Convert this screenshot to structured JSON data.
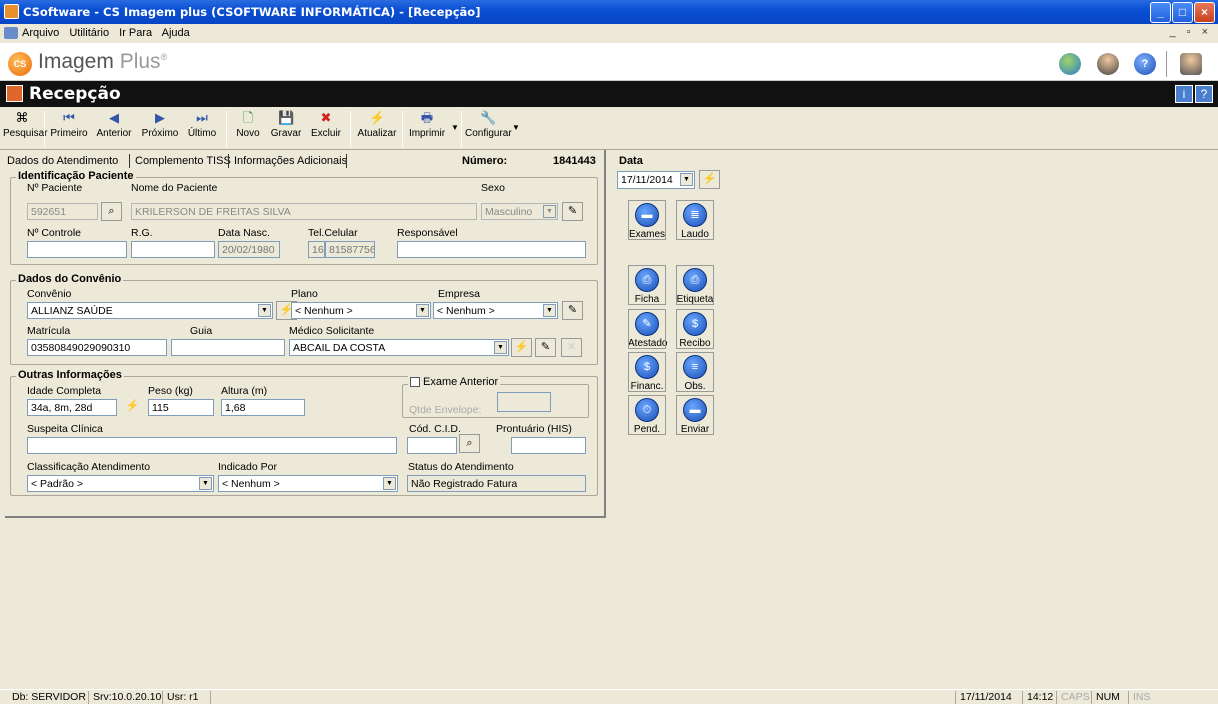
{
  "window": {
    "title": "CSoftware - CS Imagem plus (CSOFTWARE INFORMÁTICA) - [Recepção]",
    "controls": {
      "minimize": "_",
      "maximize": "□",
      "close": "×"
    }
  },
  "menu": {
    "items": [
      "Arquivo",
      "Utilitário",
      "Ir Para",
      "Ajuda"
    ],
    "mdi_controls": "_ ▫ ×"
  },
  "logo": {
    "badge": "CS",
    "brand": "Imagem",
    "brand_plus": "Plus",
    "trademark": "®"
  },
  "header": {
    "title": "Recepção"
  },
  "toolbar": {
    "buttons": [
      {
        "label": "Pesquisar",
        "icon": "binoculars-icon",
        "glyph": "⌘"
      },
      {
        "label": "Primeiro",
        "icon": "first-icon",
        "glyph": "⏮"
      },
      {
        "label": "Anterior",
        "icon": "previous-icon",
        "glyph": "◀"
      },
      {
        "label": "Próximo",
        "icon": "next-icon",
        "glyph": "▶"
      },
      {
        "label": "Último",
        "icon": "last-icon",
        "glyph": "⏭"
      },
      {
        "label": "Novo",
        "icon": "new-document-icon",
        "glyph": "🗋"
      },
      {
        "label": "Gravar",
        "icon": "save-icon",
        "glyph": "💾"
      },
      {
        "label": "Excluir",
        "icon": "delete-icon",
        "glyph": "✖"
      },
      {
        "label": "Atualizar",
        "icon": "lightning-icon",
        "glyph": "⚡"
      },
      {
        "label": "Imprimir",
        "icon": "print-icon",
        "glyph": "🖶"
      },
      {
        "label": "Configurar",
        "icon": "wrench-icon",
        "glyph": "🔧"
      }
    ]
  },
  "tabs": [
    "Dados do Atendimento",
    "Complemento TISS",
    "Informações Adicionais"
  ],
  "numero": {
    "label": "Número:",
    "value": "1841443"
  },
  "data": {
    "label": "Data",
    "value": "17/11/2014"
  },
  "identificacao": {
    "title": "Identificação Paciente",
    "n_paciente_label": "Nº Paciente",
    "n_paciente": "592651",
    "nome_label": "Nome do Paciente",
    "nome": "KRILERSON DE FREITAS SILVA",
    "sexo_label": "Sexo",
    "sexo": "Masculino",
    "n_controle_label": "Nº Controle",
    "n_controle": "",
    "rg_label": "R.G.",
    "rg": "",
    "nasc_label": "Data Nasc.",
    "nasc": "20/02/1980",
    "tel_label": "Tel.Celular",
    "tel_ddd": "16",
    "tel": "81587756",
    "resp_label": "Responsável",
    "resp": ""
  },
  "convenio": {
    "title": "Dados do Convênio",
    "convenio_label": "Convênio",
    "convenio": "ALLIANZ SAÚDE",
    "plano_label": "Plano",
    "plano": "< Nenhum >",
    "empresa_label": "Empresa",
    "empresa": "< Nenhum >",
    "matricula_label": "Matrícula",
    "matricula": "03580849029090310",
    "guia_label": "Guia",
    "guia": "",
    "medico_label": "Médico Solicitante",
    "medico": "ABCAIL DA COSTA"
  },
  "outras": {
    "title": "Outras Informações",
    "idade_label": "Idade Completa",
    "idade": "34a, 8m, 28d",
    "peso_label": "Peso (kg)",
    "peso": "115",
    "altura_label": "Altura (m)",
    "altura": "1,68",
    "exame_anterior_label": "Exame Anterior",
    "qtde_label": "Qtde Envelope:",
    "suspeita_label": "Suspeita Clínica",
    "suspeita": "",
    "cid_label": "Cód. C.I.D.",
    "cid": "",
    "prontuario_label": "Prontuário (HIS)",
    "prontuario": "",
    "classif_label": "Classificação Atendimento",
    "classif": "< Padrão >",
    "indicado_label": "Indicado Por",
    "indicado": "< Nenhum >",
    "status_label": "Status do Atendimento",
    "status": "Não Registrado Fatura"
  },
  "side_buttons": {
    "exames": "Exames",
    "laudo": "Laudo",
    "ficha": "Ficha",
    "etiqueta": "Etiqueta",
    "atestado": "Atestado",
    "recibo": "Recibo",
    "financ": "Financ.",
    "obs": "Obs.",
    "pend": "Pend.",
    "enviar": "Enviar"
  },
  "statusbar": {
    "db": "Db: SERVIDOR",
    "srv": "Srv:10.0.20.10",
    "usr": "Usr: r1",
    "date": "17/11/2014",
    "time": "14:12",
    "caps": "CAPS",
    "num": "NUM",
    "ins": "INS"
  }
}
